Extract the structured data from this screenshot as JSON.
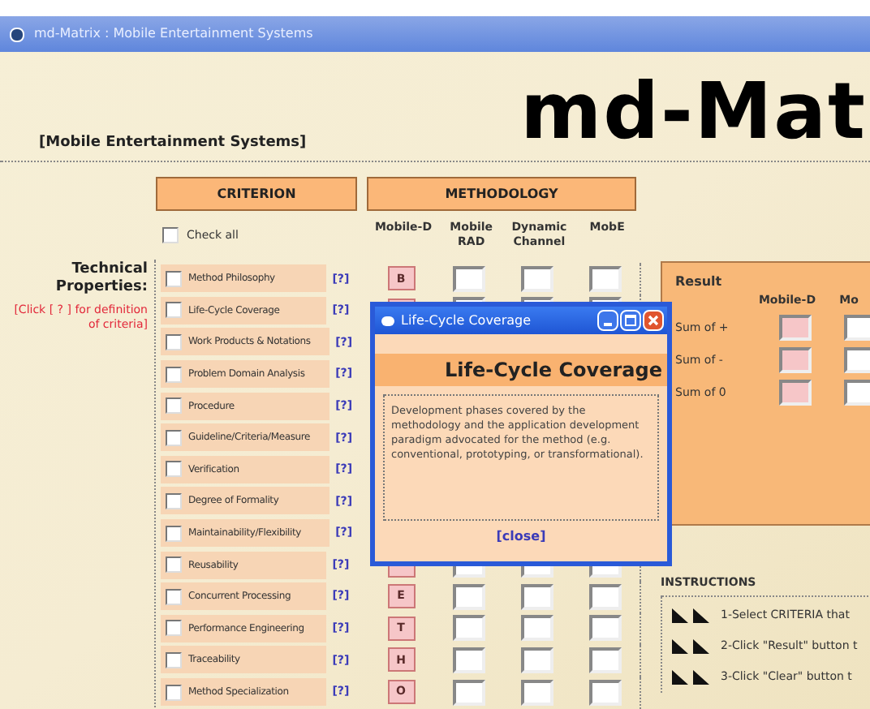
{
  "window": {
    "title": "md-Matrix : Mobile Entertainment Systems"
  },
  "logo": "md-Mat",
  "subtitle": "[Mobile Entertainment Systems]",
  "headers": {
    "criterion": "CRITERION",
    "methodology": "METHODOLOGY"
  },
  "check_all": {
    "label": "Check all",
    "checked": false
  },
  "columns": [
    "Mobile-D",
    "Mobile RAD",
    "Dynamic Channel",
    "MobE"
  ],
  "section": {
    "title": "Technical Properties:",
    "hint": "[Click [ ? ] for definition of criteria]"
  },
  "criteria": [
    {
      "label": "Method Philosophy",
      "checked": false,
      "help": "[?]",
      "letter": "B"
    },
    {
      "label": "Life-Cycle Coverage",
      "checked": false,
      "help": "[?]"
    },
    {
      "label": "Work Products & Notations",
      "checked": false,
      "help": "[?]",
      "kind": "covered"
    },
    {
      "label": "Problem Domain Analysis",
      "checked": false,
      "help": "[?]",
      "kind": "covered"
    },
    {
      "label": "Procedure",
      "checked": false,
      "help": "[?]",
      "kind": "covered"
    },
    {
      "label": "Guideline/Criteria/Measure",
      "checked": false,
      "help": "[?]",
      "kind": "covered"
    },
    {
      "label": "Verification",
      "checked": false,
      "help": "[?]",
      "kind": "covered"
    },
    {
      "label": "Degree of Formality",
      "checked": false,
      "help": "[?]",
      "kind": "covered"
    },
    {
      "label": "Maintainability/Flexibility",
      "checked": false,
      "help": "[?]",
      "kind": "covered"
    },
    {
      "label": "Reusability",
      "checked": false,
      "help": "[?]"
    },
    {
      "label": "Concurrent Processing",
      "checked": false,
      "help": "[?]",
      "letter": "E"
    },
    {
      "label": "Performance Engineering",
      "checked": false,
      "help": "[?]",
      "letter": "T"
    },
    {
      "label": "Traceability",
      "checked": false,
      "help": "[?]",
      "letter": "H"
    },
    {
      "label": "Method Specialization",
      "checked": false,
      "help": "[?]",
      "letter": "O"
    }
  ],
  "popup": {
    "title": "Life-Cycle Coverage",
    "heading": "Life-Cycle Coverage",
    "text": "Development phases covered by the methodology and the application development paradigm advocated for the method (e.g. conventional, prototyping, or transformational).",
    "close": "[close]"
  },
  "result": {
    "title": "Result",
    "columns": [
      "Mobile-D",
      "Mo"
    ],
    "rows": [
      "Sum of +",
      "Sum of -",
      "Sum of 0"
    ]
  },
  "instructions": {
    "title": "INSTRUCTIONS",
    "items": [
      "1-Select CRITERIA that",
      "2-Click \"Result\" button t",
      "3-Click \"Clear\" button t"
    ]
  }
}
